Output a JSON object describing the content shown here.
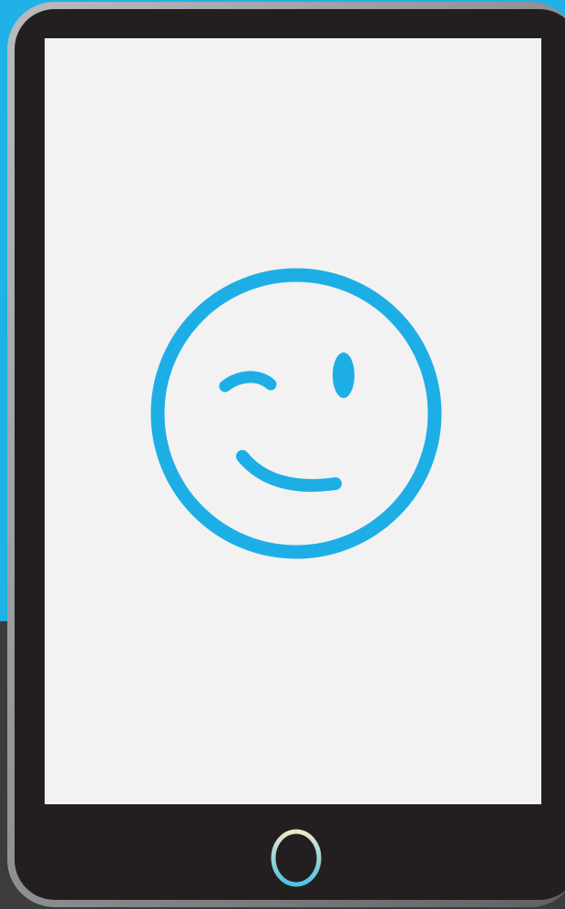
{
  "colors": {
    "background_top": "#1fb1e7",
    "background_bottom": "#3c3c3c",
    "device_body": "#231f20",
    "device_frame": "#8d8f92",
    "screen": "#f2f2f2",
    "emoji": "#1eaee6",
    "home_button_ring_top": "#e9e9c7",
    "home_button_ring_bottom": "#4fc1e4"
  },
  "device": {
    "screen": {
      "icon": "winking-face-icon"
    },
    "home_button": {
      "icon": "home-button-ring-icon"
    }
  }
}
